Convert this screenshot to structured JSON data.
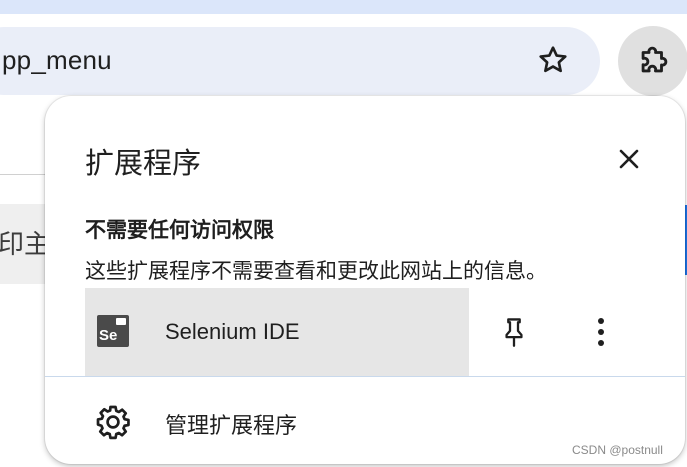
{
  "browser": {
    "omnibox_text": "pp_menu",
    "bookmark_icon": "star-outline-icon",
    "extensions_icon": "puzzle-piece-icon"
  },
  "background_page": {
    "partial_text": "印主"
  },
  "extensions_popup": {
    "title": "扩展程序",
    "close_icon": "close-icon",
    "section_heading": "不需要任何访问权限",
    "section_description": "这些扩展程序不需要查看和更改此网站上的信息。",
    "extensions": [
      {
        "name": "Selenium IDE",
        "logo_text": "Se",
        "pin_icon": "pin-icon",
        "more_icon": "more-vertical-icon"
      }
    ],
    "manage_label": "管理扩展程序",
    "manage_icon": "gear-icon"
  },
  "watermark": "CSDN @postnull",
  "colors": {
    "accent_blue": "#1a73e8",
    "omnibox_bg": "#eaeef8",
    "row_highlight": "#e6e6e6"
  }
}
